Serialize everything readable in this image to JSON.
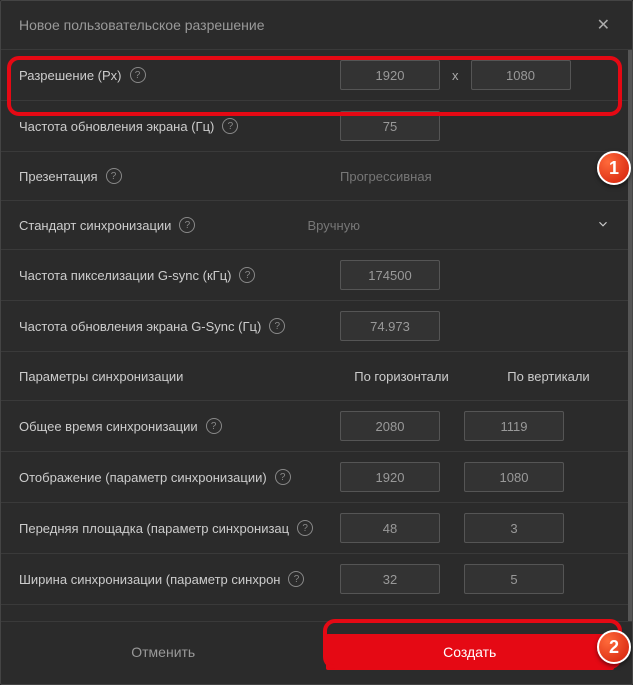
{
  "header": {
    "title": "Новое пользовательское разрешение"
  },
  "rows": {
    "resolution": {
      "label": "Разрешение (Px)",
      "width": "1920",
      "height": "1080",
      "sep": "x"
    },
    "refresh": {
      "label": "Частота обновления экрана (Гц)",
      "value": "75"
    },
    "presentation": {
      "label": "Презентация",
      "value": "Прогрессивная"
    },
    "sync_std": {
      "label": "Стандарт синхронизации",
      "value": "Вручную"
    },
    "pixel_clock": {
      "label": "Частота пикселизации G-sync (кГц)",
      "value": "174500"
    },
    "gsync_refresh": {
      "label": "Частота обновления экрана G-Sync (Гц)",
      "value": "74.973"
    },
    "sync_params": {
      "label": "Параметры синхронизации",
      "col1": "По горизонтали",
      "col2": "По вертикали"
    },
    "total": {
      "label": "Общее время синхронизации",
      "h": "2080",
      "v": "1119"
    },
    "display": {
      "label": "Отображение (параметр синхронизации)",
      "h": "1920",
      "v": "1080"
    },
    "front_porch": {
      "label": "Передняя площадка (параметр синхронизац",
      "h": "48",
      "v": "3"
    },
    "sync_width": {
      "label": "Ширина синхронизации (параметр синхрон",
      "h": "32",
      "v": "5"
    }
  },
  "footer": {
    "cancel": "Отменить",
    "create": "Создать"
  },
  "badges": {
    "one": "1",
    "two": "2"
  }
}
